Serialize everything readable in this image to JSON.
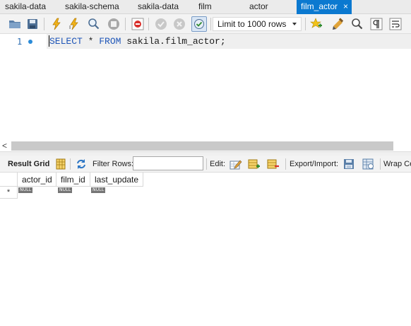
{
  "tabs": [
    {
      "label": "sakila-data",
      "active": false
    },
    {
      "label": "sakila-schema",
      "active": false
    },
    {
      "label": "sakila-data",
      "active": false
    },
    {
      "label": "film",
      "active": false
    },
    {
      "label": "actor",
      "active": false
    },
    {
      "label": "film_actor",
      "active": true
    }
  ],
  "active_tab_close": "×",
  "toolbar": {
    "icons": [
      "open-folder-icon",
      "save-icon",
      "execute-icon",
      "execute-current-icon",
      "explain-icon",
      "stop-icon",
      "stop-on-error-icon",
      "commit-icon",
      "rollback-icon",
      "autocommit-icon",
      "add-snippet-icon",
      "beautify-icon",
      "find-icon",
      "invisible-chars-icon",
      "word-wrap-icon"
    ],
    "limit_select": "Limit to 1000 rows"
  },
  "editor": {
    "line_number": "1",
    "sql": {
      "kw1": "SELECT",
      "star": " * ",
      "kw2": "FROM",
      "rest": " sakila.film_actor;"
    }
  },
  "scroll_left_arrow": "<",
  "result_toolbar": {
    "result_grid": "Result Grid",
    "filter_rows": "Filter Rows:",
    "edit": "Edit:",
    "export_import": "Export/Import:",
    "wrap": "Wrap Ce"
  },
  "grid": {
    "columns": [
      "actor_id",
      "film_id",
      "last_update"
    ],
    "new_row_marker": "*",
    "null_label": "NULL"
  },
  "colors": {
    "active_tab": "#0b79d0",
    "keyword": "#1f56b8"
  }
}
